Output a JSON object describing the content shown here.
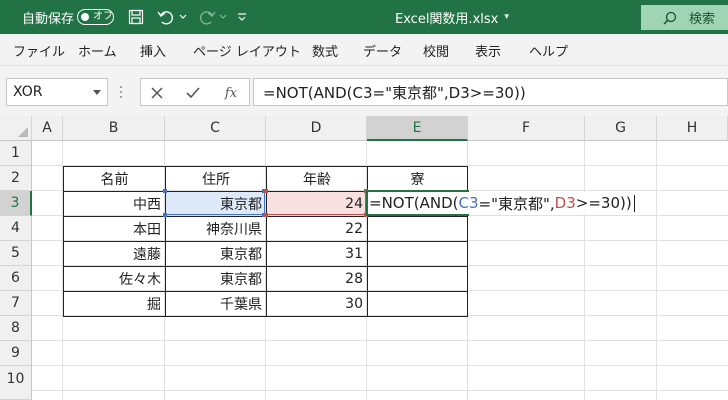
{
  "titlebar": {
    "autosave_label": "自動保存",
    "autosave_state": "オフ",
    "filename": "Excel関数用.xlsx",
    "search_label": "検索"
  },
  "menu": [
    "ファイル",
    "ホーム",
    "挿入",
    "ページ レイアウト",
    "数式",
    "データ",
    "校閲",
    "表示",
    "ヘルプ"
  ],
  "formula_bar": {
    "name_box": "XOR",
    "fx_symbol": "fx",
    "formula": "=NOT(AND(C3=\"東京都\",D3>=30))"
  },
  "sheet": {
    "columns": [
      "A",
      "B",
      "C",
      "D",
      "E",
      "F",
      "G",
      "H"
    ],
    "rows": [
      "1",
      "2",
      "3",
      "4",
      "5",
      "6",
      "7",
      "8",
      "9",
      "10"
    ],
    "headers": {
      "name": "名前",
      "address": "住所",
      "age": "年齢",
      "extra": "寮"
    },
    "records": [
      {
        "name": "中西",
        "address": "東京都",
        "age": "24"
      },
      {
        "name": "本田",
        "address": "神奈川県",
        "age": "22"
      },
      {
        "name": "遠藤",
        "address": "東京都",
        "age": "31"
      },
      {
        "name": "佐々木",
        "address": "東京都",
        "age": "28"
      },
      {
        "name": "掘",
        "address": "千葉県",
        "age": "30"
      }
    ],
    "editing": {
      "p1": "=NOT(AND(",
      "ref1": "C3",
      "p2": "=\"東京都\",",
      "ref2": "D3",
      "p3": ">=30))"
    },
    "selected_column": "E",
    "selected_row": "3"
  },
  "colors": {
    "accent": "#217346",
    "ref_c3": "#4472c4",
    "ref_d3": "#c0504d"
  }
}
